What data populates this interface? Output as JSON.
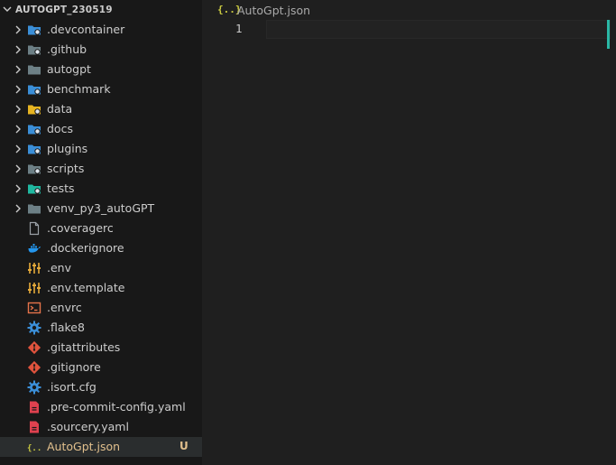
{
  "explorer": {
    "title": "AUTOGPT_230519",
    "items": [
      {
        "label": ".devcontainer",
        "kind": "folder",
        "icon": "devcontainer-folder-icon",
        "color": "#3b8fd8",
        "badge": ""
      },
      {
        "label": ".github",
        "kind": "folder",
        "icon": "github-folder-icon",
        "color": "#6d8086",
        "badge": ""
      },
      {
        "label": "autogpt",
        "kind": "folder",
        "icon": "folder-icon",
        "color": "#6d8086",
        "badge": ""
      },
      {
        "label": "benchmark",
        "kind": "folder",
        "icon": "benchmark-folder-icon",
        "color": "#3b8fd8",
        "badge": ""
      },
      {
        "label": "data",
        "kind": "folder",
        "icon": "data-folder-icon",
        "color": "#e6b422",
        "badge": ""
      },
      {
        "label": "docs",
        "kind": "folder",
        "icon": "docs-folder-icon",
        "color": "#3b8fd8",
        "badge": ""
      },
      {
        "label": "plugins",
        "kind": "folder",
        "icon": "plugins-folder-icon",
        "color": "#3b8fd8",
        "badge": ""
      },
      {
        "label": "scripts",
        "kind": "folder",
        "icon": "scripts-folder-icon",
        "color": "#6d8086",
        "badge": ""
      },
      {
        "label": "tests",
        "kind": "folder",
        "icon": "tests-folder-icon",
        "color": "#20b8a0",
        "badge": ""
      },
      {
        "label": "venv_py3_autoGPT",
        "kind": "folder",
        "icon": "folder-icon",
        "color": "#6d8086",
        "badge": ""
      },
      {
        "label": ".coveragerc",
        "kind": "file",
        "icon": "file-icon",
        "color": "#9aa0a6",
        "badge": ""
      },
      {
        "label": ".dockerignore",
        "kind": "file",
        "icon": "docker-icon",
        "color": "#2496ed",
        "badge": ""
      },
      {
        "label": ".env",
        "kind": "file",
        "icon": "env-settings-icon",
        "color": "#e5a93a",
        "badge": ""
      },
      {
        "label": ".env.template",
        "kind": "file",
        "icon": "env-settings-icon",
        "color": "#e5a93a",
        "badge": ""
      },
      {
        "label": ".envrc",
        "kind": "file",
        "icon": "terminal-icon",
        "color": "#e5734a",
        "badge": ""
      },
      {
        "label": ".flake8",
        "kind": "file",
        "icon": "gear-icon",
        "color": "#3b8fd8",
        "badge": ""
      },
      {
        "label": ".gitattributes",
        "kind": "file",
        "icon": "git-icon",
        "color": "#e0533d",
        "badge": ""
      },
      {
        "label": ".gitignore",
        "kind": "file",
        "icon": "git-icon",
        "color": "#e0533d",
        "badge": ""
      },
      {
        "label": ".isort.cfg",
        "kind": "file",
        "icon": "gear-icon",
        "color": "#3b8fd8",
        "badge": ""
      },
      {
        "label": ".pre-commit-config.yaml",
        "kind": "file",
        "icon": "yaml-icon",
        "color": "#e0414f",
        "badge": ""
      },
      {
        "label": ".sourcery.yaml",
        "kind": "file",
        "icon": "yaml-icon",
        "color": "#e0414f",
        "badge": ""
      },
      {
        "label": "AutoGpt.json",
        "kind": "file",
        "icon": "json-icon",
        "color": "#cbcb41",
        "badge": "U",
        "selected": true
      }
    ]
  },
  "editor": {
    "tab": {
      "icon_glyph": "{..}",
      "label": "AutoGpt.json"
    },
    "line_number": "1"
  },
  "colors": {
    "sidebar_bg": "#181818",
    "editor_bg": "#1f1f1f",
    "selected_row": "#2a2d2e",
    "untracked": "#e2c08d",
    "caret": "#2ab7a5"
  }
}
